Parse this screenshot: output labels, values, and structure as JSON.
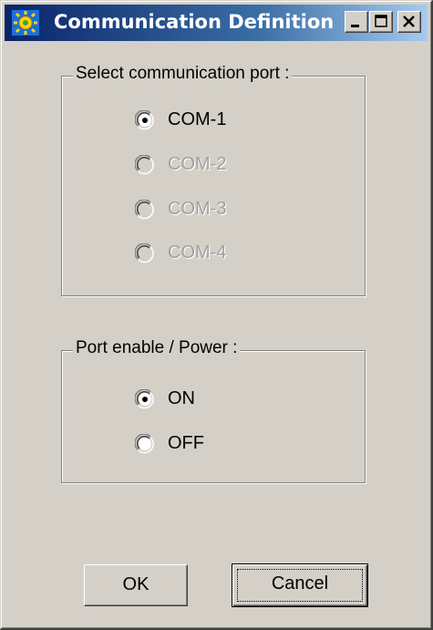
{
  "window": {
    "title": "Communication Definition",
    "icon": "sun-gear-icon",
    "controls": {
      "minimize_icon": "minimize-icon",
      "maximize_icon": "maximize-icon",
      "close_icon": "close-icon"
    }
  },
  "port_group": {
    "label": "Select communication port :",
    "options": [
      {
        "label": "COM-1",
        "selected": true,
        "enabled": true
      },
      {
        "label": "COM-2",
        "selected": false,
        "enabled": false
      },
      {
        "label": "COM-3",
        "selected": false,
        "enabled": false
      },
      {
        "label": "COM-4",
        "selected": false,
        "enabled": false
      }
    ]
  },
  "power_group": {
    "label": "Port enable / Power :",
    "options": [
      {
        "label": "ON",
        "selected": true,
        "enabled": true
      },
      {
        "label": "OFF",
        "selected": false,
        "enabled": true
      }
    ]
  },
  "buttons": {
    "ok_label": "OK",
    "cancel_label": "Cancel"
  },
  "colors": {
    "face": "#d4d0c8",
    "title_start": "#0a246a",
    "title_end": "#a6caf0",
    "disabled_text": "#a0a0a0"
  }
}
